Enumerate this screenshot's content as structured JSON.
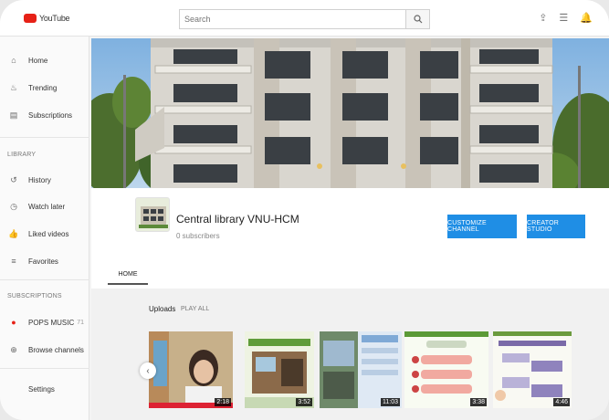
{
  "topbar": {
    "logo_text": "YouTube",
    "search_placeholder": "Search"
  },
  "sidebar": {
    "main": [
      {
        "label": "Home",
        "icon": "home-icon"
      },
      {
        "label": "Trending",
        "icon": "flame-icon"
      },
      {
        "label": "Subscriptions",
        "icon": "subscriptions-icon"
      }
    ],
    "library_heading": "LIBRARY",
    "library": [
      {
        "label": "History",
        "icon": "history-icon"
      },
      {
        "label": "Watch later",
        "icon": "clock-icon"
      },
      {
        "label": "Liked videos",
        "icon": "thumb-up-icon"
      },
      {
        "label": "Favorites",
        "icon": "playlist-icon"
      }
    ],
    "subscriptions_heading": "SUBSCRIPTIONS",
    "subscriptions": [
      {
        "label": "POPS MUSIC",
        "count": "71"
      },
      {
        "label": "Browse channels",
        "count": ""
      }
    ],
    "settings_label": "Settings"
  },
  "channel": {
    "name": "Central library VNU-HCM",
    "subscribers": "0 subscribers",
    "customize_label": "CUSTOMIZE CHANNEL",
    "creator_label": "CREATOR STUDIO",
    "tab_home": "HOME"
  },
  "uploads": {
    "title": "Uploads",
    "play_all": "PLAY ALL",
    "videos": [
      {
        "duration": "2:18"
      },
      {
        "duration": "3:52"
      },
      {
        "duration": "11:03"
      },
      {
        "duration": "3:38"
      },
      {
        "duration": "4:46"
      }
    ]
  },
  "colors": {
    "accent_blue": "#1f8ee5",
    "youtube_red": "#e62117"
  }
}
